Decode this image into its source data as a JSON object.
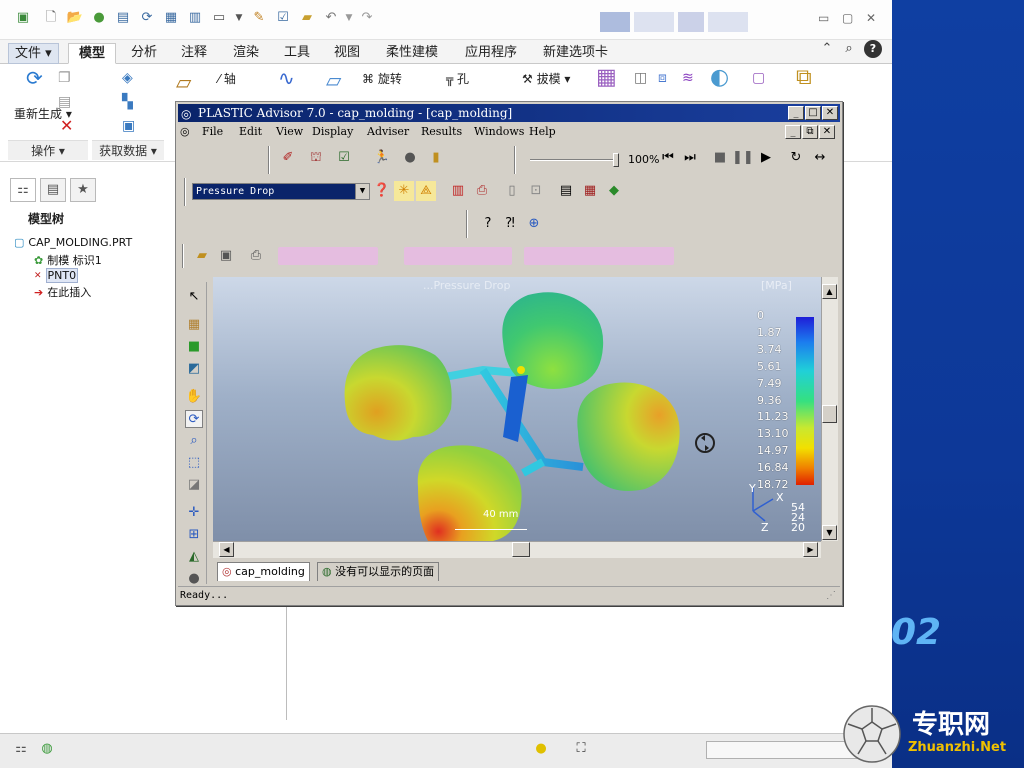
{
  "creo": {
    "tabs": [
      "文件",
      "模型",
      "分析",
      "注释",
      "渲染",
      "工具",
      "视图",
      "柔性建模",
      "应用程序",
      "新建选项卡"
    ],
    "active_tab": "模型",
    "ribbon": {
      "regenerate_label": "重新生成",
      "axis_label": "轴",
      "revolve_label": "旋转",
      "hole_label": "孔",
      "draft_label": "拔模",
      "group_operations": "操作",
      "group_get_data": "获取数据"
    },
    "model_tree": {
      "title": "模型树",
      "nodes": [
        "CAP_MOLDING.PRT",
        "制模 标识1",
        "PNT0",
        "在此插入"
      ]
    }
  },
  "pa": {
    "title": "PLASTIC Advisor 7.0 - cap_molding - [cap_molding]",
    "menu": [
      "File",
      "Edit",
      "View",
      "Display",
      "Adviser",
      "Results",
      "Windows",
      "Help"
    ],
    "zoom": "100%",
    "result_select": "Pressure Drop",
    "view_title": "...Pressure Drop",
    "unit": "[MPa]",
    "scale_label": "40 mm",
    "axis_x": "X",
    "axis_y": "Y",
    "axis_z": "Z",
    "axis_values": [
      "54",
      "24",
      "20"
    ],
    "doc_tabs": [
      "cap_molding",
      "没有可以显示的页面"
    ],
    "status": "Ready..."
  },
  "legend": {
    "values": [
      "0",
      "1.87",
      "3.74",
      "5.61",
      "7.49",
      "9.36",
      "11.23",
      "13.10",
      "14.97",
      "16.84",
      "18.72"
    ]
  },
  "background": {
    "version_digits": "02",
    "watermark_cn": "专职网",
    "watermark_en": "Zhuanzhi.Net"
  },
  "colors": {
    "title_bar": "#0a246a",
    "creo_bg": "#ffffff",
    "right_panel": "#0d3898"
  }
}
